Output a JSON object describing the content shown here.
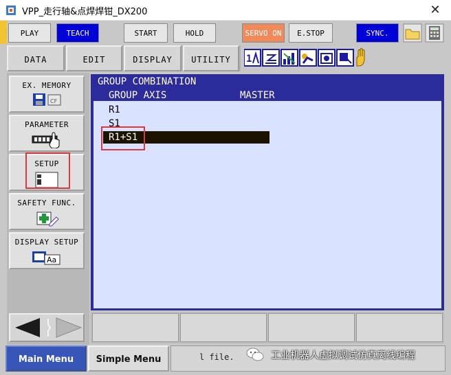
{
  "window": {
    "title": "VPP_走行轴&点焊焊钳_DX200",
    "close_glyph": "✕"
  },
  "toolbar": {
    "play": "PLAY",
    "teach": "TEACH",
    "start": "START",
    "hold": "HOLD",
    "servo_on": "SERVO ON",
    "estop": "E.STOP",
    "sync": "SYNC."
  },
  "menu": {
    "data": "DATA",
    "edit": "EDIT",
    "display": "DISPLAY",
    "utility": "UTILITY"
  },
  "status_icons": [
    "coordinate-icon",
    "edit-icon",
    "signal-level-icon",
    "robot-icon",
    "camera-icon",
    "cursor-icon",
    "hand-icon"
  ],
  "side_menu": {
    "ex_memory": "EX. MEMORY",
    "parameter": "PARAMETER",
    "setup": "SETUP",
    "safety_func": "SAFETY FUNC.",
    "display_setup": "DISPLAY SETUP"
  },
  "main": {
    "title": "GROUP COMBINATION",
    "col_group_axis": "GROUP AXIS",
    "col_master": "MASTER",
    "items": [
      "R1",
      "S1",
      "R1+S1"
    ],
    "selected_index": 2
  },
  "footer": {
    "main_menu": "Main Menu",
    "simple_menu": "Simple Menu",
    "message": "l file."
  },
  "watermark": "工业机器人虚拟调试仿真离线编程",
  "colors": {
    "teach_blue": "#0000d8",
    "servo_orange": "#f08a5a",
    "header_blue": "#2b2b9b",
    "list_bg": "#d9e3ff",
    "cursor_bar": "#1c1200",
    "annotation_red": "#e0363d",
    "main_menu_blue": "#3855b8"
  }
}
